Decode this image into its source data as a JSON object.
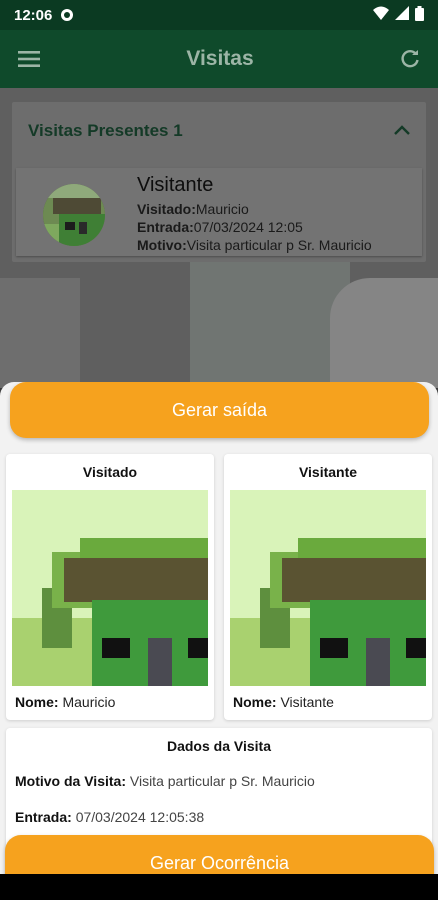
{
  "status_bar": {
    "time": "12:06"
  },
  "app_bar": {
    "title": "Visitas"
  },
  "visits_panel": {
    "title": "Visitas Presentes 1",
    "card": {
      "name": "Visitante",
      "visited_label": "Visitado:",
      "visited_value": "Mauricio",
      "entry_label": "Entrada:",
      "entry_value": "07/03/2024 12:05",
      "reason_label": "Motivo:",
      "reason_value": "Visita particular p Sr. Mauricio"
    }
  },
  "sheet": {
    "exit_button": "Gerar saída",
    "visited_card": {
      "title": "Visitado",
      "name_label": "Nome:",
      "name_value": "Mauricio"
    },
    "visitor_card": {
      "title": "Visitante",
      "name_label": "Nome:",
      "name_value": "Visitante"
    },
    "visit_data": {
      "title": "Dados da Visita",
      "reason_label": "Motivo da Visita:",
      "reason_value": "Visita particular p Sr. Mauricio",
      "entry_label": "Entrada:",
      "entry_value": "07/03/2024 12:05:38"
    },
    "occurrence_button": "Gerar Ocorrência"
  },
  "colors": {
    "app_bar": "#0f4a2b",
    "accent": "#f6a21e"
  },
  "icons": [
    "menu-icon",
    "refresh-icon",
    "chevron-up-icon",
    "wifi-icon",
    "signal-icon",
    "battery-icon"
  ]
}
